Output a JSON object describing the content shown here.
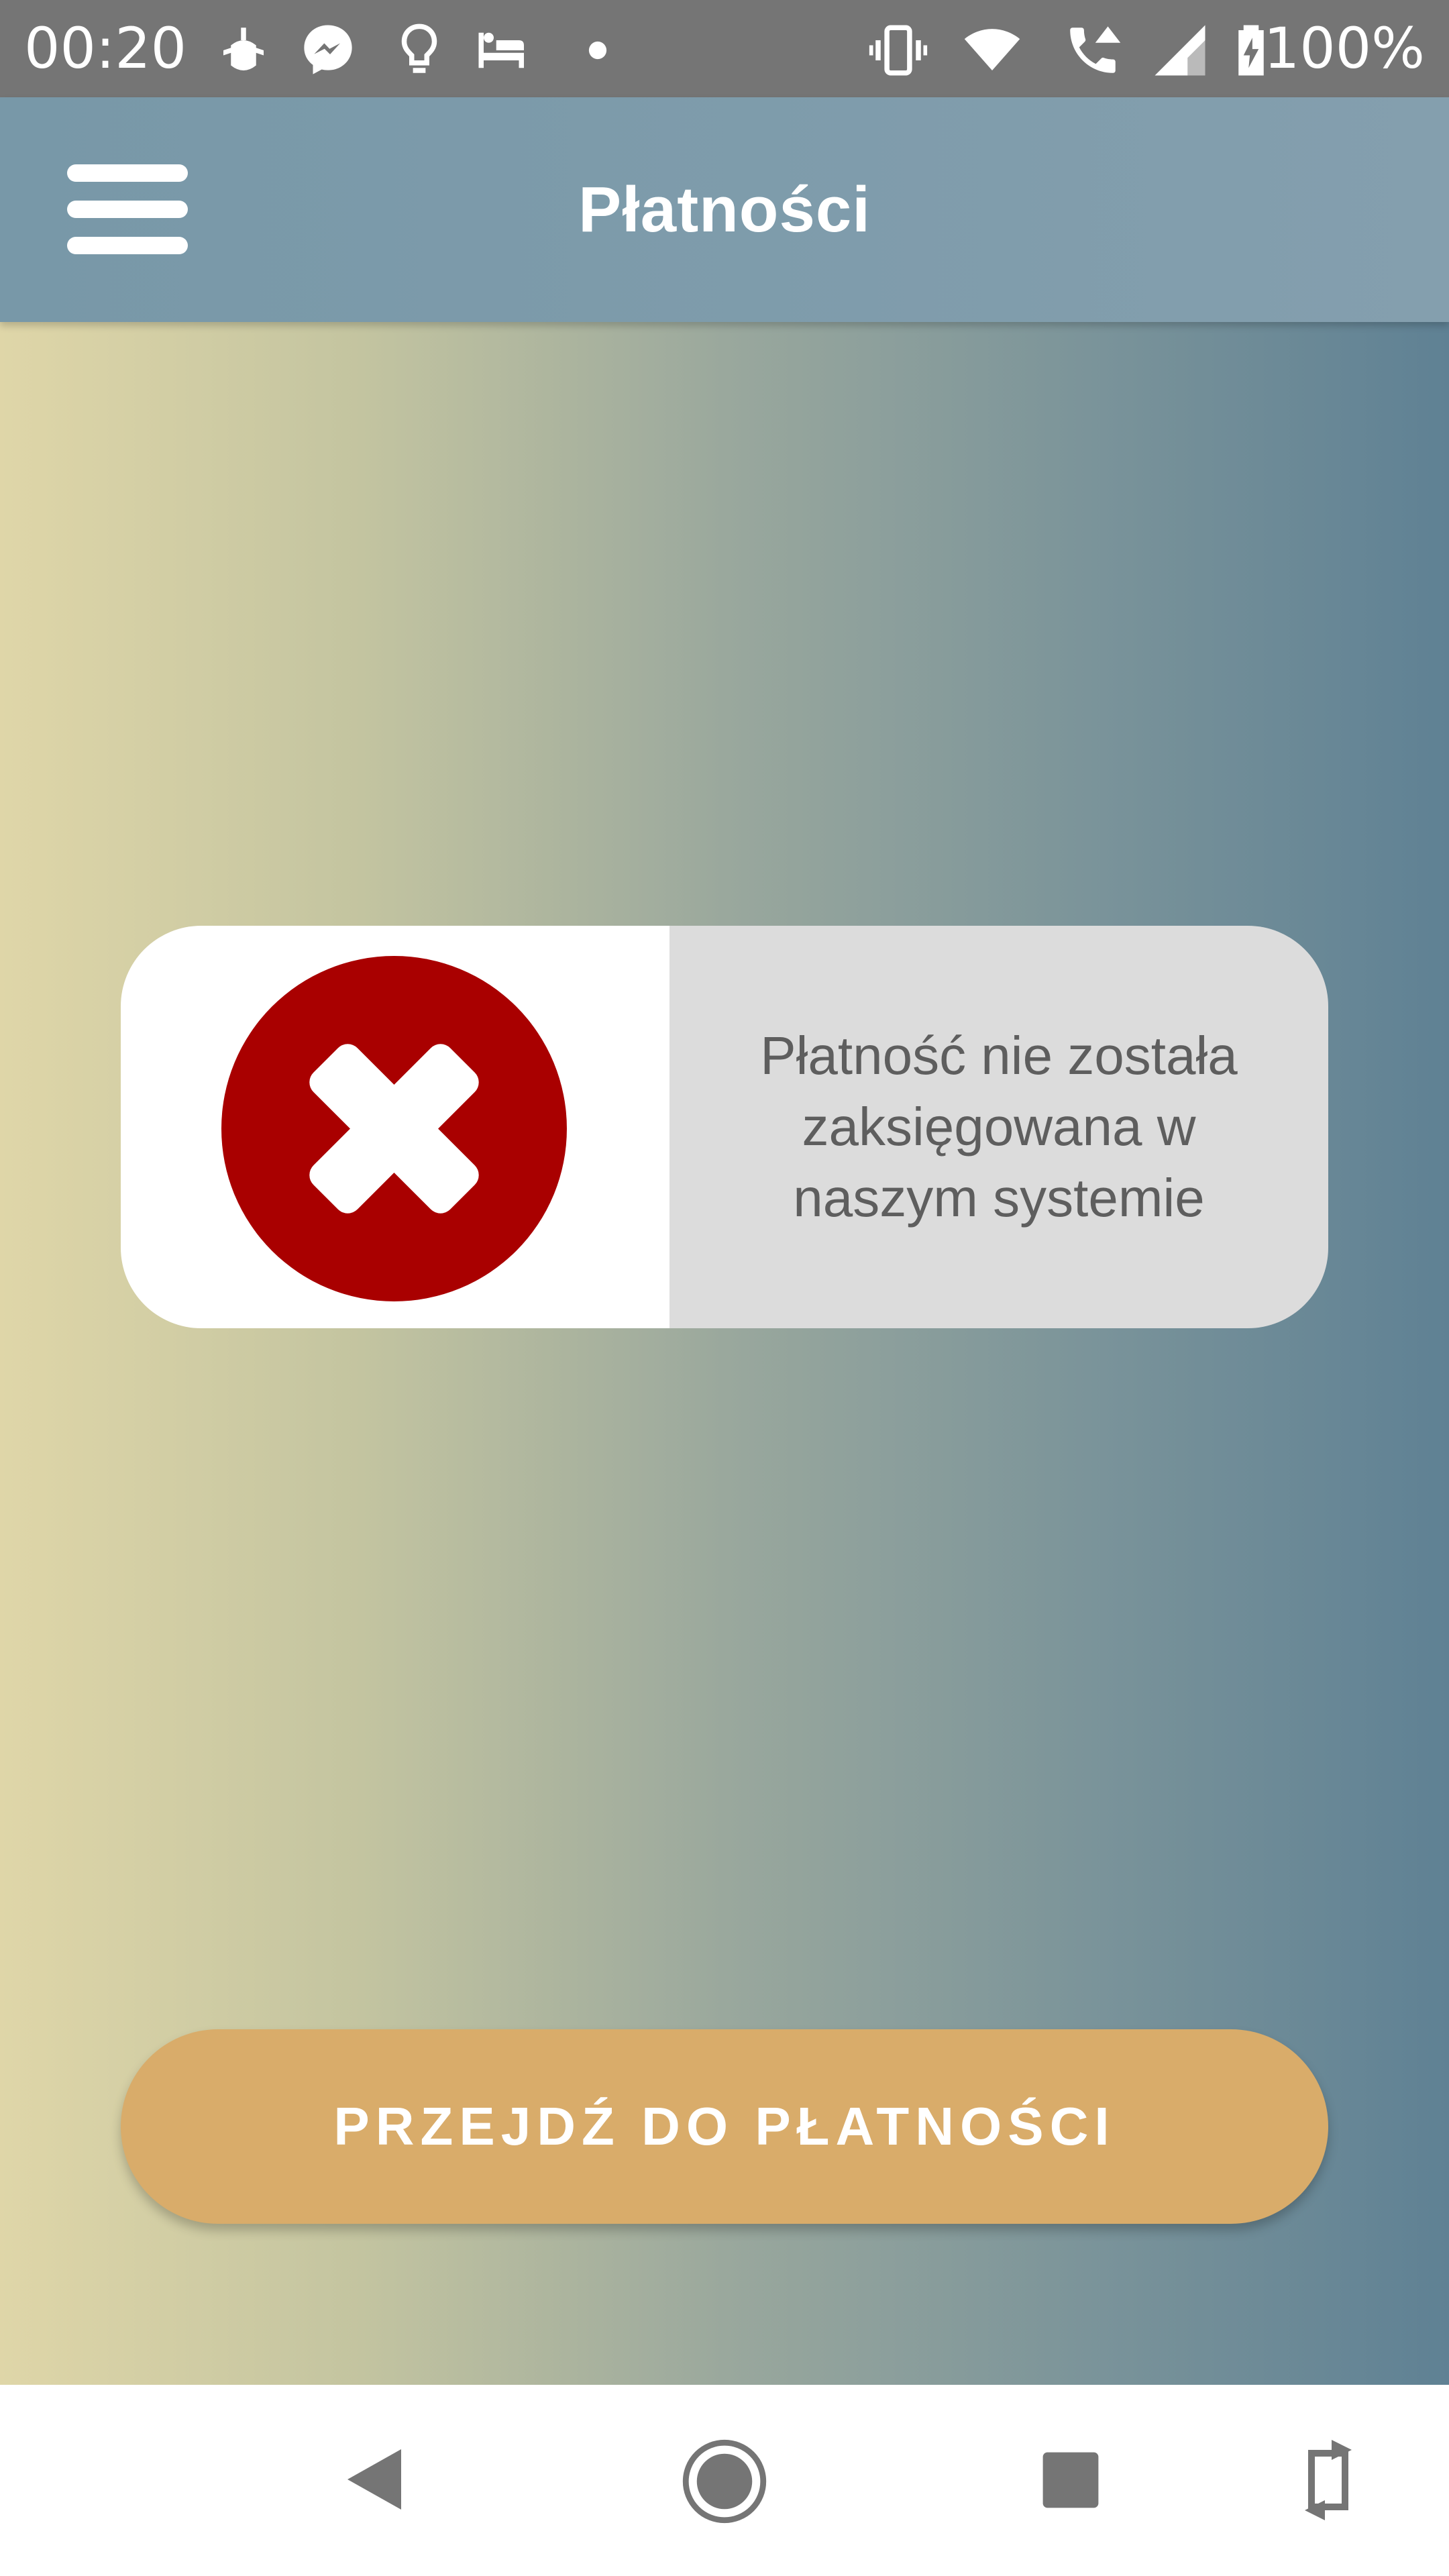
{
  "status_bar": {
    "time": "00:20",
    "battery_text": "100%",
    "icons_left": [
      "android-bug-icon",
      "messenger-icon",
      "lightbulb-icon",
      "hotel-bed-icon",
      "dot-icon"
    ],
    "icons_right": [
      "vibrate-icon",
      "wifi-icon",
      "wifi-call-icon",
      "cell-signal-icon",
      "battery-charging-icon"
    ]
  },
  "app_bar": {
    "title": "Płatności",
    "menu_icon": "hamburger-menu-icon"
  },
  "message_card": {
    "icon": "error-x-icon",
    "text": "Płatność nie została zaksięgowana w naszym systemie"
  },
  "actions": {
    "go_to_payments_label": "PRZEJDŹ DO PŁATNOŚCI"
  },
  "nav_bar": {
    "icons": [
      "back-icon",
      "home-icon",
      "recents-icon",
      "rotate-icon"
    ]
  },
  "colors": {
    "app_bar": "#7898a8",
    "error_red": "#a90000",
    "button": "#d9ac6a",
    "card_right": "#dcdcdc"
  }
}
